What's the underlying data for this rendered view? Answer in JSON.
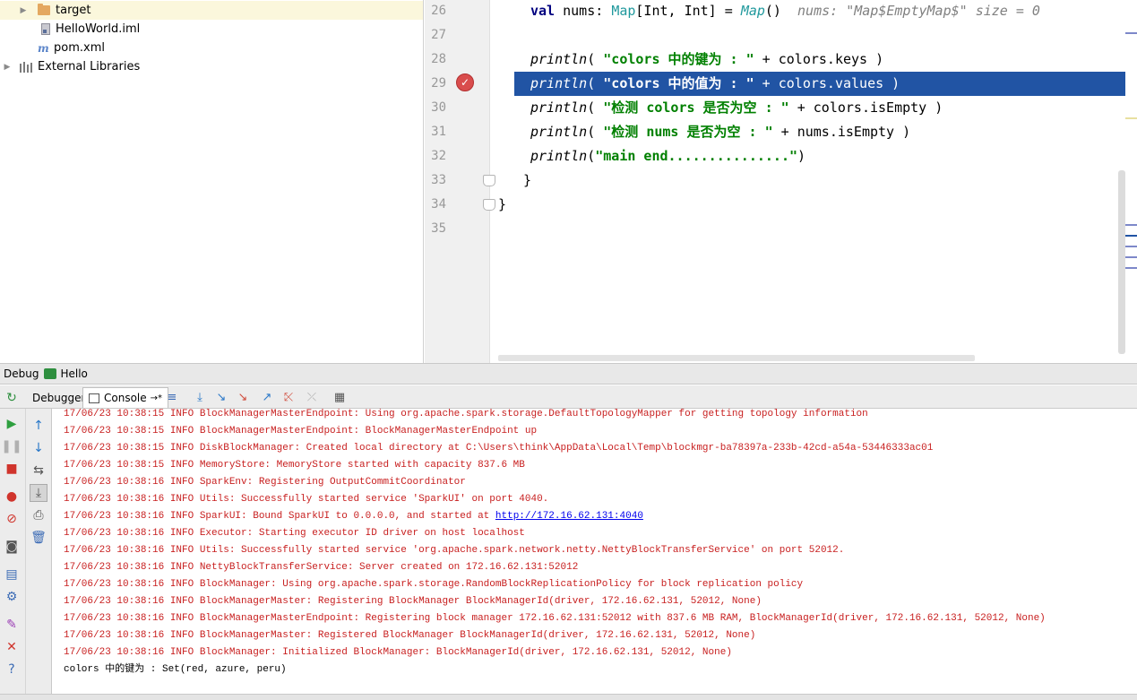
{
  "project_tree": {
    "items": [
      {
        "label": "target",
        "type": "folder",
        "expandable": true
      },
      {
        "label": "HelloWorld.iml",
        "type": "file"
      },
      {
        "label": "pom.xml",
        "type": "maven"
      },
      {
        "label": "External Libraries",
        "type": "library",
        "expandable": true
      }
    ]
  },
  "editor": {
    "line_numbers": [
      "26",
      "27",
      "28",
      "29",
      "30",
      "31",
      "32",
      "33",
      "34",
      "35"
    ],
    "lines": {
      "l26": {
        "kw": "val",
        "rest1": " nums: ",
        "type1": "Map",
        "rest2": "[Int, Int] = ",
        "fn": "Map",
        "rest3": "()  ",
        "hint": "nums: \"Map$EmptyMap$\" size = 0"
      },
      "l28": {
        "fn": "println",
        "open": "( ",
        "str": "\"colors 中的键为 : \"",
        "rest": " + colors.keys )"
      },
      "l29": {
        "fn": "println",
        "open": "( ",
        "str": "\"colors 中的值为 : \"",
        "rest": " + colors.values )"
      },
      "l30": {
        "fn": "println",
        "open": "( ",
        "str": "\"检测 colors 是否为空 : \"",
        "rest": " + colors.isEmpty )"
      },
      "l31": {
        "fn": "println",
        "open": "( ",
        "str": "\"检测 nums 是否为空 : \"",
        "rest": " + nums.isEmpty )"
      },
      "l32": {
        "fn": "println",
        "open": "(",
        "str": "\"main end...............\"",
        "rest": ")"
      },
      "l33": "  }",
      "l34": "}"
    }
  },
  "debug_bar": {
    "title": "Debug",
    "config": "Hello"
  },
  "tabs": {
    "debugger": "Debugger",
    "console": "Console",
    "console_suffix": "→*"
  },
  "console": {
    "lines": [
      "17/06/23 10:38:15 INFO BlockManagerMasterEndpoint: Using org.apache.spark.storage.DefaultTopologyMapper for getting topology information",
      "17/06/23 10:38:15 INFO BlockManagerMasterEndpoint: BlockManagerMasterEndpoint up",
      "17/06/23 10:38:15 INFO DiskBlockManager: Created local directory at C:\\Users\\think\\AppData\\Local\\Temp\\blockmgr-ba78397a-233b-42cd-a54a-53446333ac01",
      "17/06/23 10:38:15 INFO MemoryStore: MemoryStore started with capacity 837.6 MB",
      "17/06/23 10:38:16 INFO SparkEnv: Registering OutputCommitCoordinator",
      "17/06/23 10:38:16 INFO Utils: Successfully started service 'SparkUI' on port 4040.",
      "17/06/23 10:38:16 INFO SparkUI: Bound SparkUI to 0.0.0.0, and started at ",
      "17/06/23 10:38:16 INFO Executor: Starting executor ID driver on host localhost",
      "17/06/23 10:38:16 INFO Utils: Successfully started service 'org.apache.spark.network.netty.NettyBlockTransferService' on port 52012.",
      "17/06/23 10:38:16 INFO NettyBlockTransferService: Server created on 172.16.62.131:52012",
      "17/06/23 10:38:16 INFO BlockManager: Using org.apache.spark.storage.RandomBlockReplicationPolicy for block replication policy",
      "17/06/23 10:38:16 INFO BlockManagerMaster: Registering BlockManager BlockManagerId(driver, 172.16.62.131, 52012, None)",
      "17/06/23 10:38:16 INFO BlockManagerMasterEndpoint: Registering block manager 172.16.62.131:52012 with 837.6 MB RAM, BlockManagerId(driver, 172.16.62.131, 52012, None)",
      "17/06/23 10:38:16 INFO BlockManagerMaster: Registered BlockManager BlockManagerId(driver, 172.16.62.131, 52012, None)",
      "17/06/23 10:38:16 INFO BlockManager: Initialized BlockManager: BlockManagerId(driver, 172.16.62.131, 52012, None)"
    ],
    "spark_ui_link": "http://172.16.62.131:4040",
    "output_line": "colors 中的键为 : Set(red, azure, peru)"
  },
  "colors": {
    "accent": "#2154a4",
    "error_text": "#c82020",
    "string": "#008000",
    "keyword": "#000080"
  }
}
